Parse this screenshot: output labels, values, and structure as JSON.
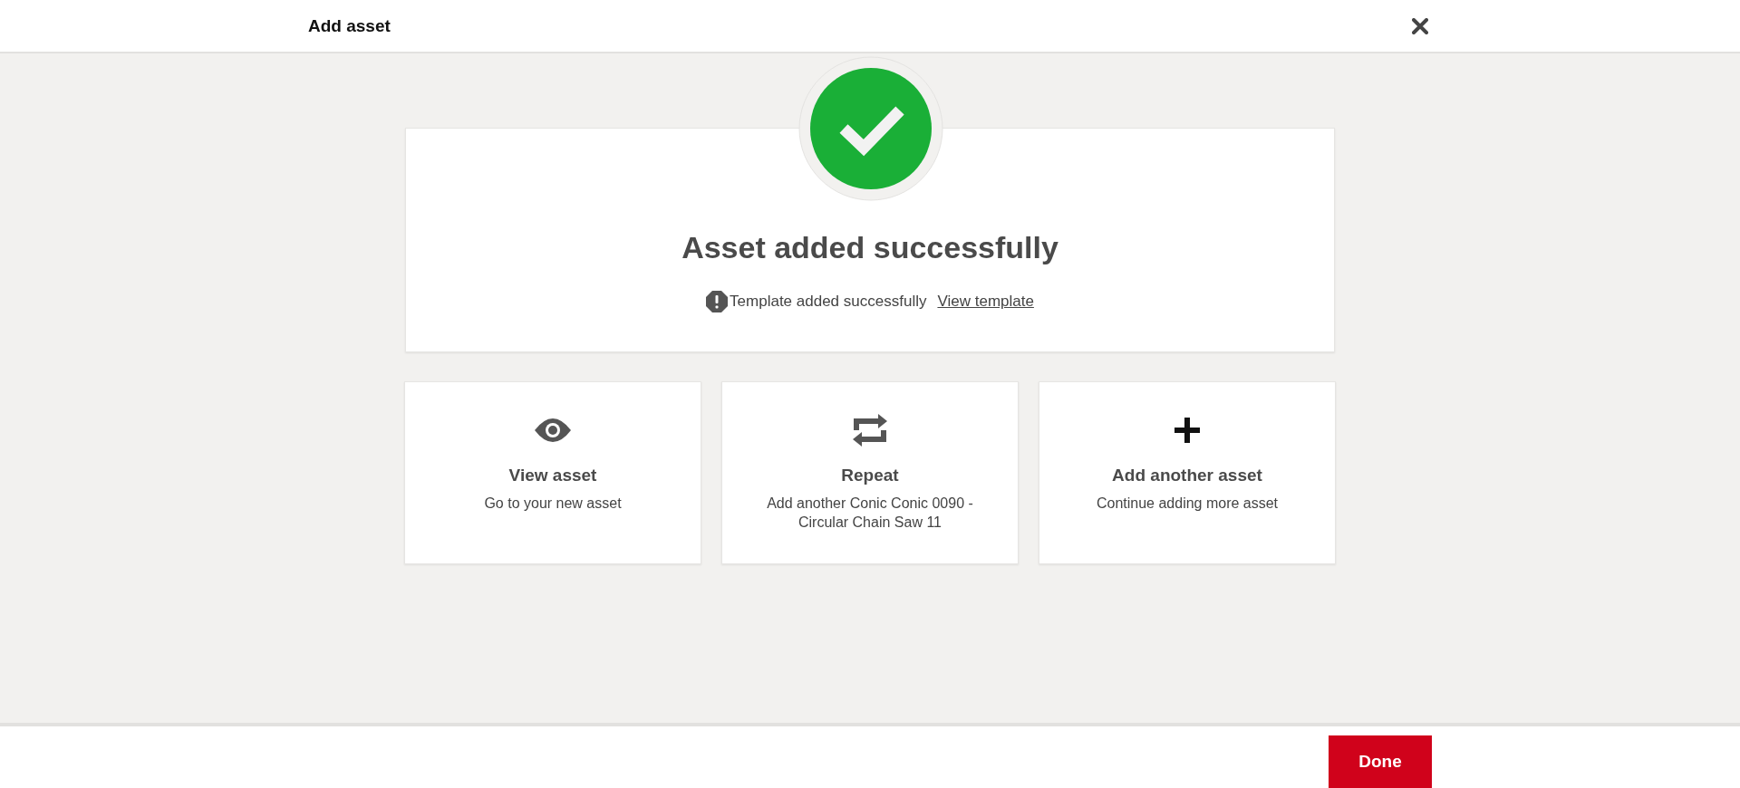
{
  "header": {
    "title": "Add asset"
  },
  "result": {
    "heading": "Asset added successfully",
    "notice": "Template added successfully",
    "link": "View template"
  },
  "tiles": [
    {
      "kind": "eye",
      "title": "View asset",
      "description": "Go to your new asset"
    },
    {
      "kind": "repeat",
      "title": "Repeat",
      "description": "Add another Conic Conic 0090 - Circular Chain Saw 11"
    },
    {
      "kind": "plus",
      "title": "Add another asset",
      "description": "Continue adding more asset"
    }
  ],
  "footer": {
    "button": "Done"
  }
}
